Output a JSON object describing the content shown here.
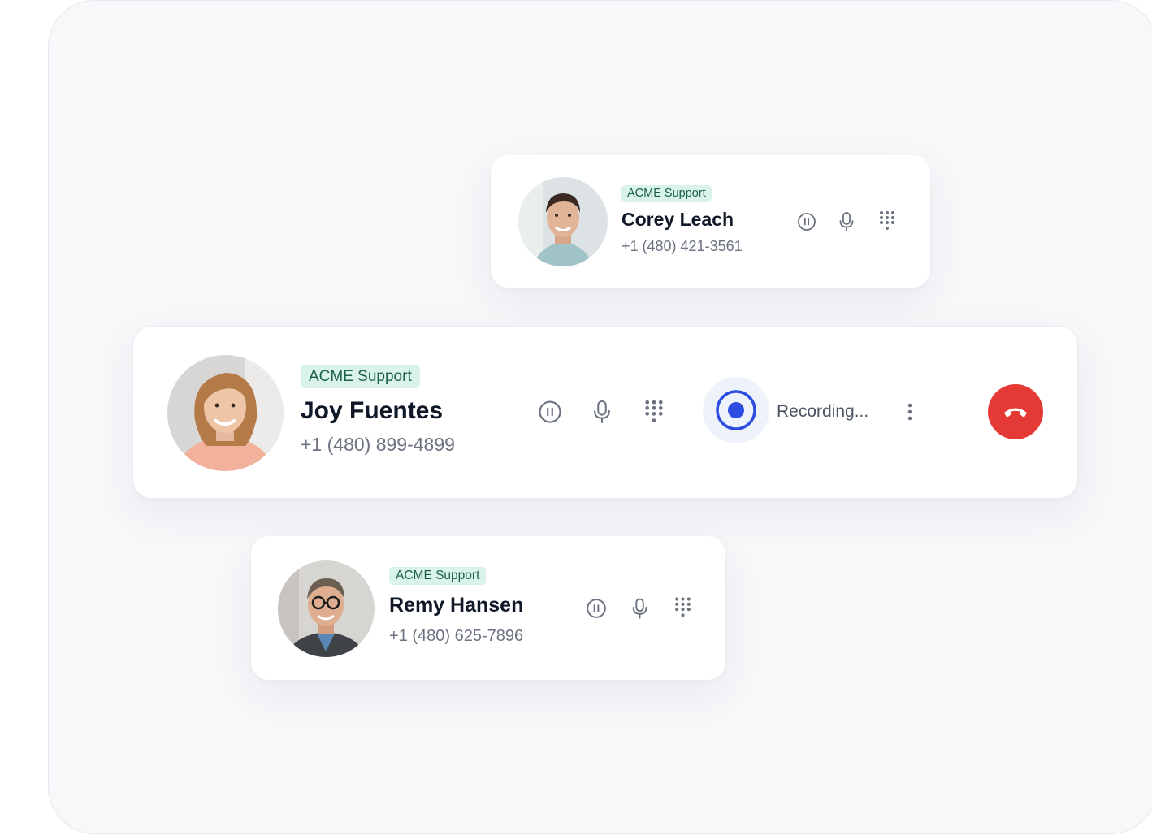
{
  "calls": [
    {
      "org_badge": "ACME Support",
      "name": "Corey Leach",
      "phone": "+1 (480) 421-3561",
      "controls": [
        "pause-icon",
        "microphone-icon",
        "dialpad-icon"
      ]
    },
    {
      "org_badge": "ACME Support",
      "name": "Joy Fuentes",
      "phone": "+1 (480) 899-4899",
      "controls": [
        "pause-icon",
        "microphone-icon",
        "dialpad-icon"
      ],
      "recording_status": "Recording...",
      "record_icon": "record-icon",
      "more_icon": "more-vertical-icon",
      "end_call_icon": "hang-up-icon"
    },
    {
      "org_badge": "ACME Support",
      "name": "Remy Hansen",
      "phone": "+1 (480) 625-7896",
      "controls": [
        "pause-icon",
        "microphone-icon",
        "dialpad-icon"
      ]
    }
  ],
  "colors": {
    "badge_bg": "#d9f2ea",
    "badge_text": "#1c5f4c",
    "record_accent": "#2d4de0",
    "end_call": "#e53935",
    "icon_gray": "#6b7280"
  }
}
